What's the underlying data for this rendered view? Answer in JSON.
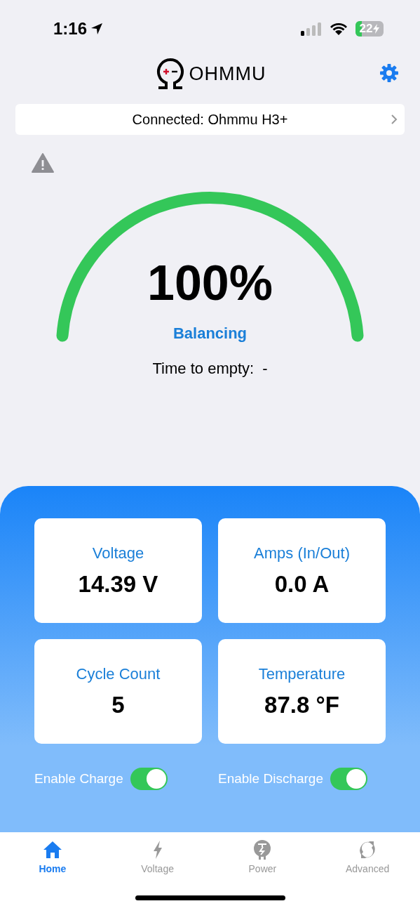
{
  "status_bar": {
    "time": "1:16",
    "battery": "22"
  },
  "header": {
    "brand": "OHMMU",
    "connection": "Connected: Ohmmu H3+",
    "warning": true
  },
  "gauge": {
    "percent": "100%",
    "state": "Balancing",
    "time_label": "Time to empty:",
    "time_value": "-"
  },
  "metrics": [
    {
      "label": "Voltage",
      "value": "14.39 V"
    },
    {
      "label": "Amps (In/Out)",
      "value": "0.0 A"
    },
    {
      "label": "Cycle Count",
      "value": "5"
    },
    {
      "label": "Temperature",
      "value": "87.8 °F"
    }
  ],
  "toggles": [
    {
      "label": "Enable Charge",
      "on": true
    },
    {
      "label": "Enable Discharge",
      "on": true
    }
  ],
  "tabs": [
    {
      "kind": "home",
      "label": "Home",
      "selected": true
    },
    {
      "kind": "bolt",
      "label": "Voltage",
      "selected": false
    },
    {
      "kind": "plug",
      "label": "Power",
      "selected": false
    },
    {
      "kind": "cycle",
      "label": "Advanced",
      "selected": false
    }
  ]
}
